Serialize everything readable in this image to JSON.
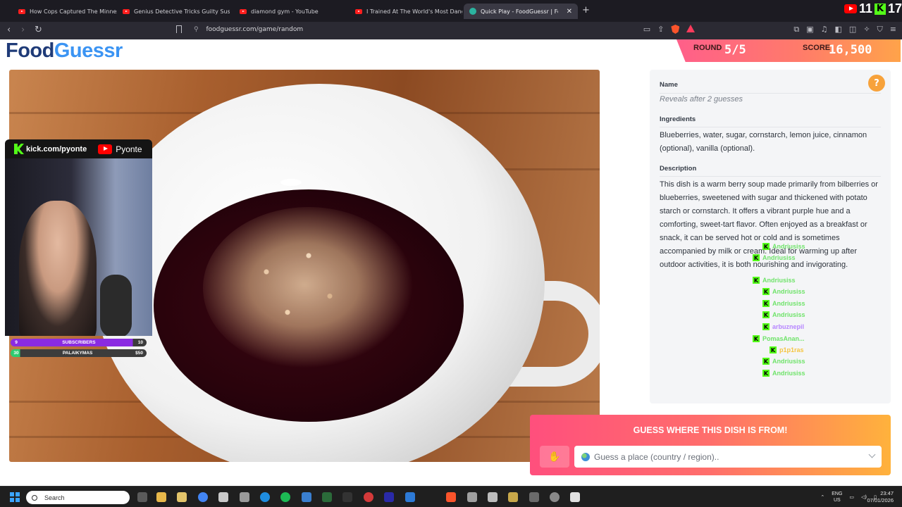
{
  "browser": {
    "tabs": [
      {
        "title": "How Cops Captured The Minnesota",
        "icon": "youtube-icon"
      },
      {
        "title": "Genius Detective Tricks Guilty Suspe",
        "icon": "youtube-icon"
      },
      {
        "title": "diamond gym - YouTube",
        "icon": "youtube-icon"
      },
      {
        "title": "I Trained At The World's Most Dange",
        "icon": "youtube-icon"
      },
      {
        "title": "Quick Play - FoodGuessr | Food",
        "icon": "foodguessr-icon",
        "active": true
      }
    ],
    "url": "foodguessr.com/game/random",
    "overlay": {
      "youtube_count": "11",
      "kick_count": "17"
    }
  },
  "game": {
    "logo_food": "Food",
    "logo_guessr": "Guessr",
    "round_label": "ROUND",
    "round_value": "5/5",
    "score_label": "SCORE",
    "score_value": "16,500",
    "accent_colors": {
      "pink": "#ff5f8a",
      "orange": "#ffa34a",
      "navy": "#1f3b78",
      "blue": "#3b94f3"
    }
  },
  "info_panel": {
    "name_heading": "Name",
    "name_reveal": "Reveals after 2 guesses",
    "ingredients_heading": "Ingredients",
    "ingredients": "Blueberries, water, sugar, cornstarch, lemon juice, cinnamon (optional), vanilla (optional).",
    "description_heading": "Description",
    "description": "This dish is a warm berry soup made primarily from bilberries or blueberries, sweetened with sugar and thickened with potato starch or cornstarch. It offers a vibrant purple hue and a comforting, sweet-tart flavor. Often enjoyed as a breakfast or snack, it can be served hot or cold and is sometimes accompanied by milk or cream. Ideal for warming up after outdoor activities, it is both nourishing and invigorating.",
    "help_icon": "question-icon"
  },
  "guess": {
    "title": "GUESS WHERE THIS DISH IS FROM!",
    "placeholder": "Guess a place (country / region)..",
    "hint_icon": "hand-icon"
  },
  "stream_overlay": {
    "kick_handle": "kick.com/pyonte",
    "youtube_name": "Pyonte",
    "goals": [
      {
        "left": "9",
        "label": "SUBSCRIBERS",
        "right": "10",
        "progress": 0.9
      },
      {
        "left": "30",
        "label": "PALAIKYMAS",
        "right": "$50",
        "progress": 0.07
      }
    ]
  },
  "chat": [
    {
      "user": "Andriusiss",
      "color": "#6fe36a",
      "msg": ""
    },
    {
      "user": "Andriusiss",
      "color": "#6fe36a",
      "msg": ""
    },
    {
      "user": "Andriusiss",
      "color": "#6fe36a",
      "msg": ""
    },
    {
      "user": "Andriusiss",
      "color": "#6fe36a",
      "msg": ""
    },
    {
      "user": "Andriusiss",
      "color": "#6fe36a",
      "msg": ""
    },
    {
      "user": "Andriusiss",
      "color": "#6fe36a",
      "msg": ""
    },
    {
      "user": "arbuznepil",
      "color": "#b685ff",
      "msg": ""
    },
    {
      "user": "PomasAnan...",
      "color": "#6fe36a",
      "msg": ""
    },
    {
      "user": "p1p1ras",
      "color": "#f5c542",
      "msg": ""
    },
    {
      "user": "Andriusiss",
      "color": "#6fe36a",
      "msg": ""
    },
    {
      "user": "Andriusiss",
      "color": "#6fe36a",
      "msg": ""
    }
  ],
  "taskbar": {
    "search_placeholder": "Search",
    "lang_top": "ENG",
    "lang_bottom": "US",
    "time": "23:47",
    "date": "07/01/2026"
  }
}
